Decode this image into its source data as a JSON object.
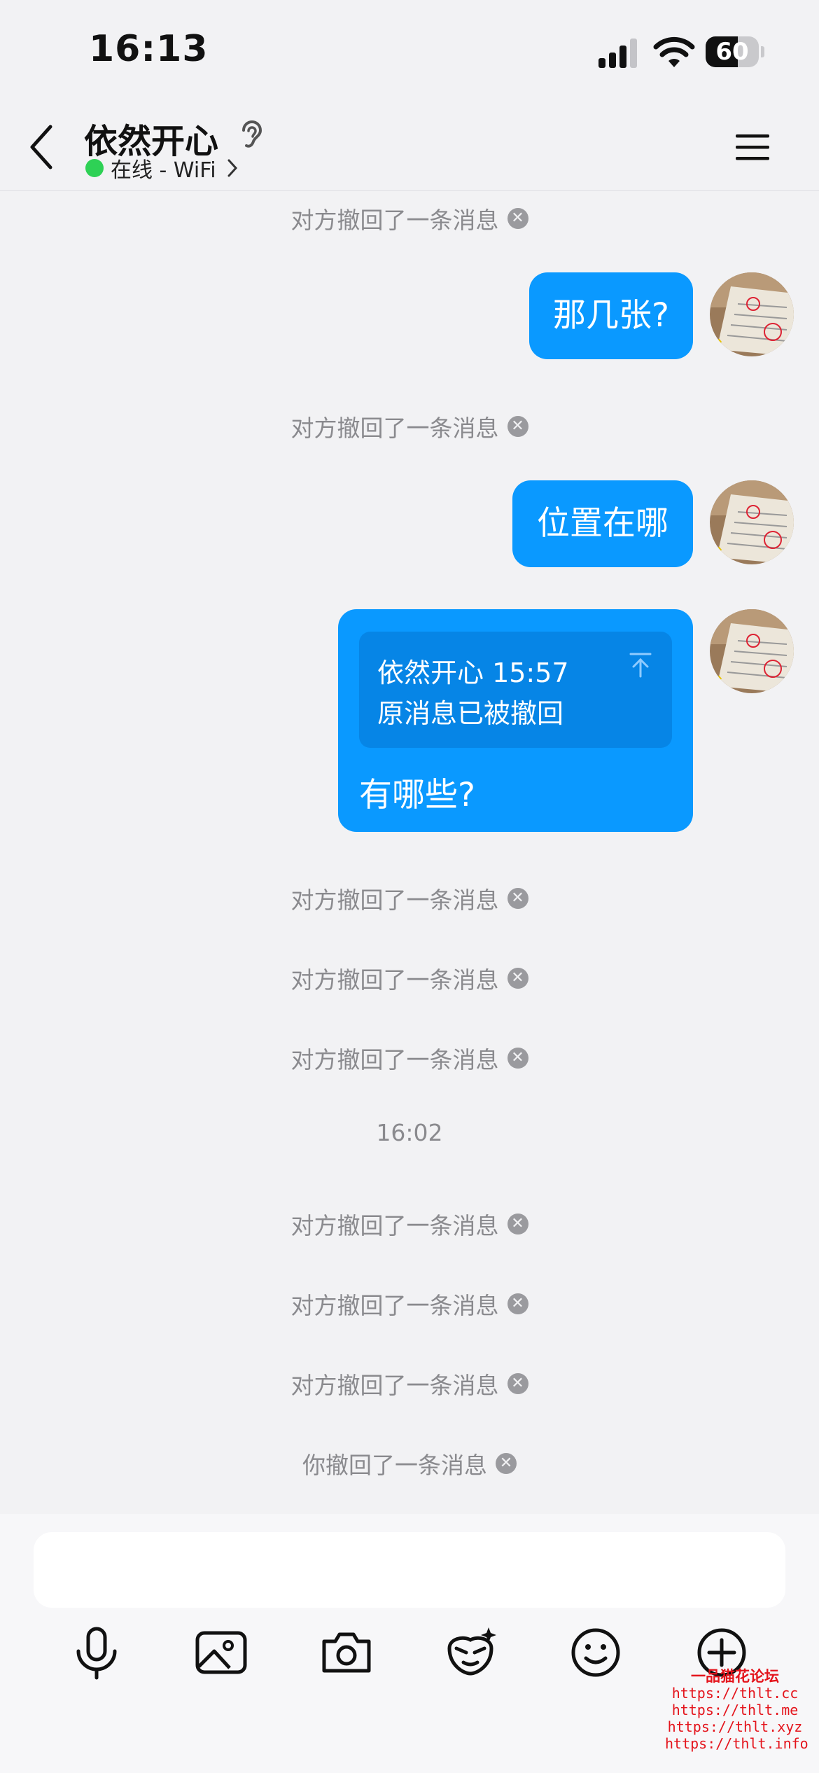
{
  "status_bar": {
    "time": "16:13",
    "battery": "60",
    "battery_level": 0.6
  },
  "header": {
    "title": "依然开心",
    "status": "在线 - WiFi"
  },
  "messages": {
    "recalled_other": "对方撤回了一条消息",
    "recalled_self": "你撤回了一条消息",
    "timestamp": "16:02",
    "bubble1": "那几张?",
    "bubble2": "位置在哪",
    "quote_name_time": "依然开心 15:57",
    "quote_text": "原消息已被撤回",
    "bubble3": "有哪些?"
  },
  "toolbar": {
    "icons": [
      "microphone-icon",
      "image-icon",
      "camera-icon",
      "sticker-icon",
      "emoji-icon",
      "plus-icon"
    ]
  },
  "watermark": {
    "title": "一品猫花论坛",
    "lines": [
      "https://thlt.cc",
      "https://thlt.me",
      "https://thlt.xyz",
      "https://thlt.info"
    ]
  },
  "colors": {
    "bubble": "#0a99ff",
    "quote": "#0685e6",
    "online": "#2ed155",
    "watermark": "#e4141c"
  }
}
